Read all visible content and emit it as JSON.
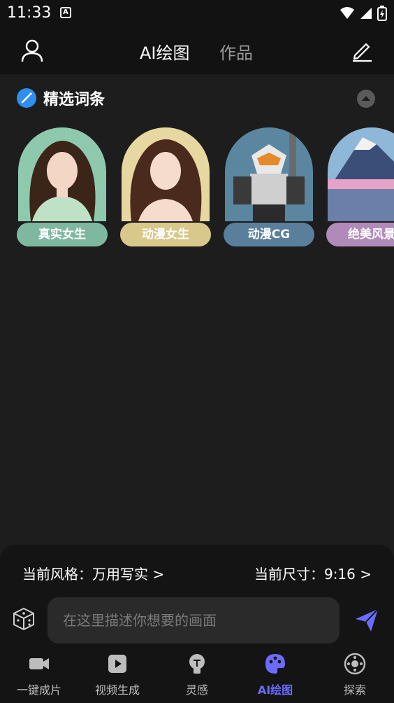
{
  "status_bar": {
    "time": "11:33",
    "notif_letter": "A"
  },
  "top_nav": {
    "tabs": [
      {
        "label": "AI绘图",
        "active": true
      },
      {
        "label": "作品",
        "active": false
      }
    ]
  },
  "section": {
    "title": "精选词条"
  },
  "cards": [
    {
      "label": "真实女生",
      "color": "#7fb8a0"
    },
    {
      "label": "动漫女生",
      "color": "#d8c88a"
    },
    {
      "label": "动漫CG",
      "color": "#5a7f9a"
    },
    {
      "label": "绝美风景",
      "color": "#b08ab8"
    }
  ],
  "bottom_panel": {
    "style": "当前风格：万用写实 >",
    "size": "当前尺寸：9:16 >",
    "prompt_placeholder": "在这里描述你想要的画面"
  },
  "tab_bar": {
    "tabs": [
      {
        "label": "一键成片",
        "icon": "video-camera-icon",
        "active": false
      },
      {
        "label": "视频生成",
        "icon": "video-play-icon",
        "active": false
      },
      {
        "label": "灵感",
        "icon": "lightbulb-icon",
        "active": false
      },
      {
        "label": "AI绘图",
        "icon": "palette-icon",
        "active": true
      },
      {
        "label": "探索",
        "icon": "explore-icon",
        "active": false
      }
    ]
  },
  "colors": {
    "accent": "#6b6bff",
    "background": "#1d1d1d",
    "panel": "#141414"
  }
}
